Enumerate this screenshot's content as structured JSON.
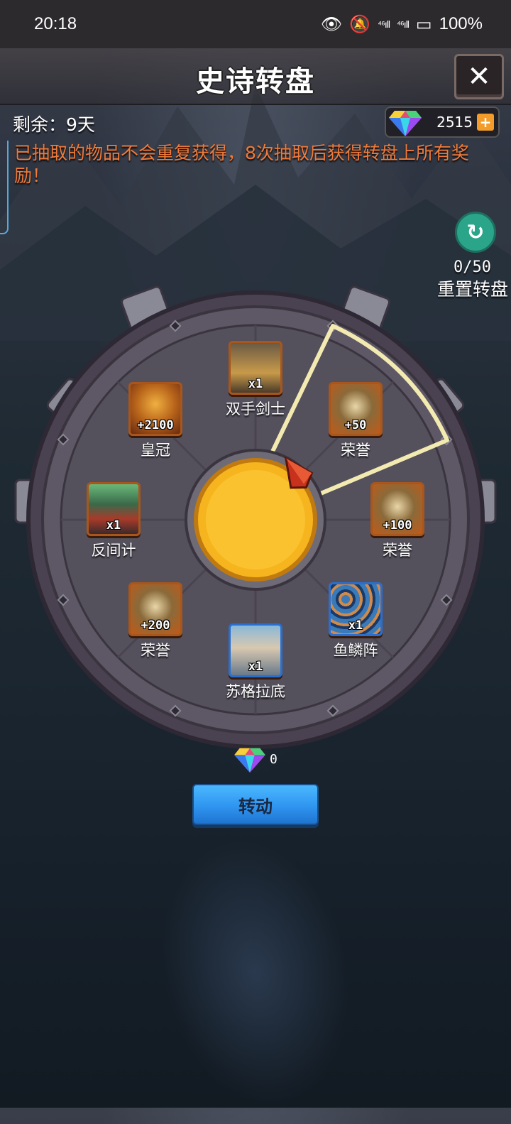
{
  "status_bar": {
    "time": "20:18",
    "signal1": "⁴⁶ıll",
    "signal2": "⁴⁶ıll",
    "battery": "100%"
  },
  "header": {
    "title": "史诗转盘",
    "close_label": "✕"
  },
  "info": {
    "remaining": "剩余：9天",
    "gems": "2515",
    "gems_plus": "+",
    "notice": "已抽取的物品不会重复获得，8次抽取后获得转盘上所有奖励！"
  },
  "reset": {
    "count": "0/50",
    "label": "重置转盘"
  },
  "wheel": {
    "prizes": [
      {
        "label": "双手剑士",
        "amount": "x1",
        "icon": "swordsman-icon"
      },
      {
        "label": "荣誉",
        "amount": "+50",
        "icon": "honor-icon"
      },
      {
        "label": "荣誉",
        "amount": "+100",
        "icon": "honor-icon"
      },
      {
        "label": "鱼鳞阵",
        "amount": "x1",
        "icon": "fish-scale-formation-icon"
      },
      {
        "label": "苏格拉底",
        "amount": "x1",
        "icon": "socrates-icon"
      },
      {
        "label": "荣誉",
        "amount": "+200",
        "icon": "honor-icon"
      },
      {
        "label": "反间计",
        "amount": "x1",
        "icon": "spy-icon"
      },
      {
        "label": "皇冠",
        "amount": "+2100",
        "icon": "crown-icon"
      }
    ]
  },
  "spin": {
    "cost": "0",
    "button_label": "转动"
  },
  "colors": {
    "notice": "#f07a3a",
    "spin_button": "#2f95f0",
    "hub": "#f6b51e",
    "highlight": "#f2eab0"
  }
}
